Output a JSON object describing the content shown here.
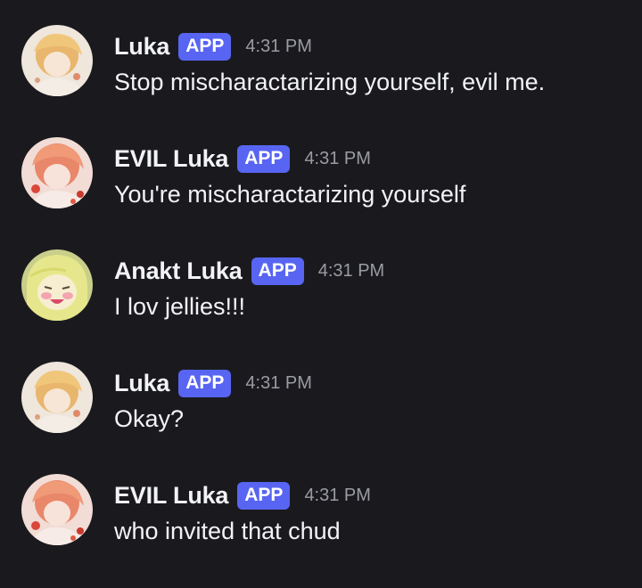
{
  "messages": [
    {
      "avatar": "luka-avatar",
      "username": "Luka",
      "badge": "APP",
      "time": "4:31 PM",
      "text": "Stop mischaractarizing yourself, evil me."
    },
    {
      "avatar": "evil-luka-avatar",
      "username": "EVIL Luka",
      "badge": "APP",
      "time": "4:31 PM",
      "text": "You're mischaractarizing yourself"
    },
    {
      "avatar": "anakt-luka-avatar",
      "username": "Anakt Luka",
      "badge": "APP",
      "time": "4:31 PM",
      "text": "I lov jellies!!!"
    },
    {
      "avatar": "luka-avatar",
      "username": "Luka",
      "badge": "APP",
      "time": "4:31 PM",
      "text": "Okay?"
    },
    {
      "avatar": "evil-luka-avatar",
      "username": "EVIL Luka",
      "badge": "APP",
      "time": "4:31 PM",
      "text": "who invited that chud"
    }
  ],
  "colors": {
    "background": "#1a1a1e",
    "badge": "#5865f2",
    "username": "#f2f3f5",
    "timestamp": "#9a9ca2"
  }
}
